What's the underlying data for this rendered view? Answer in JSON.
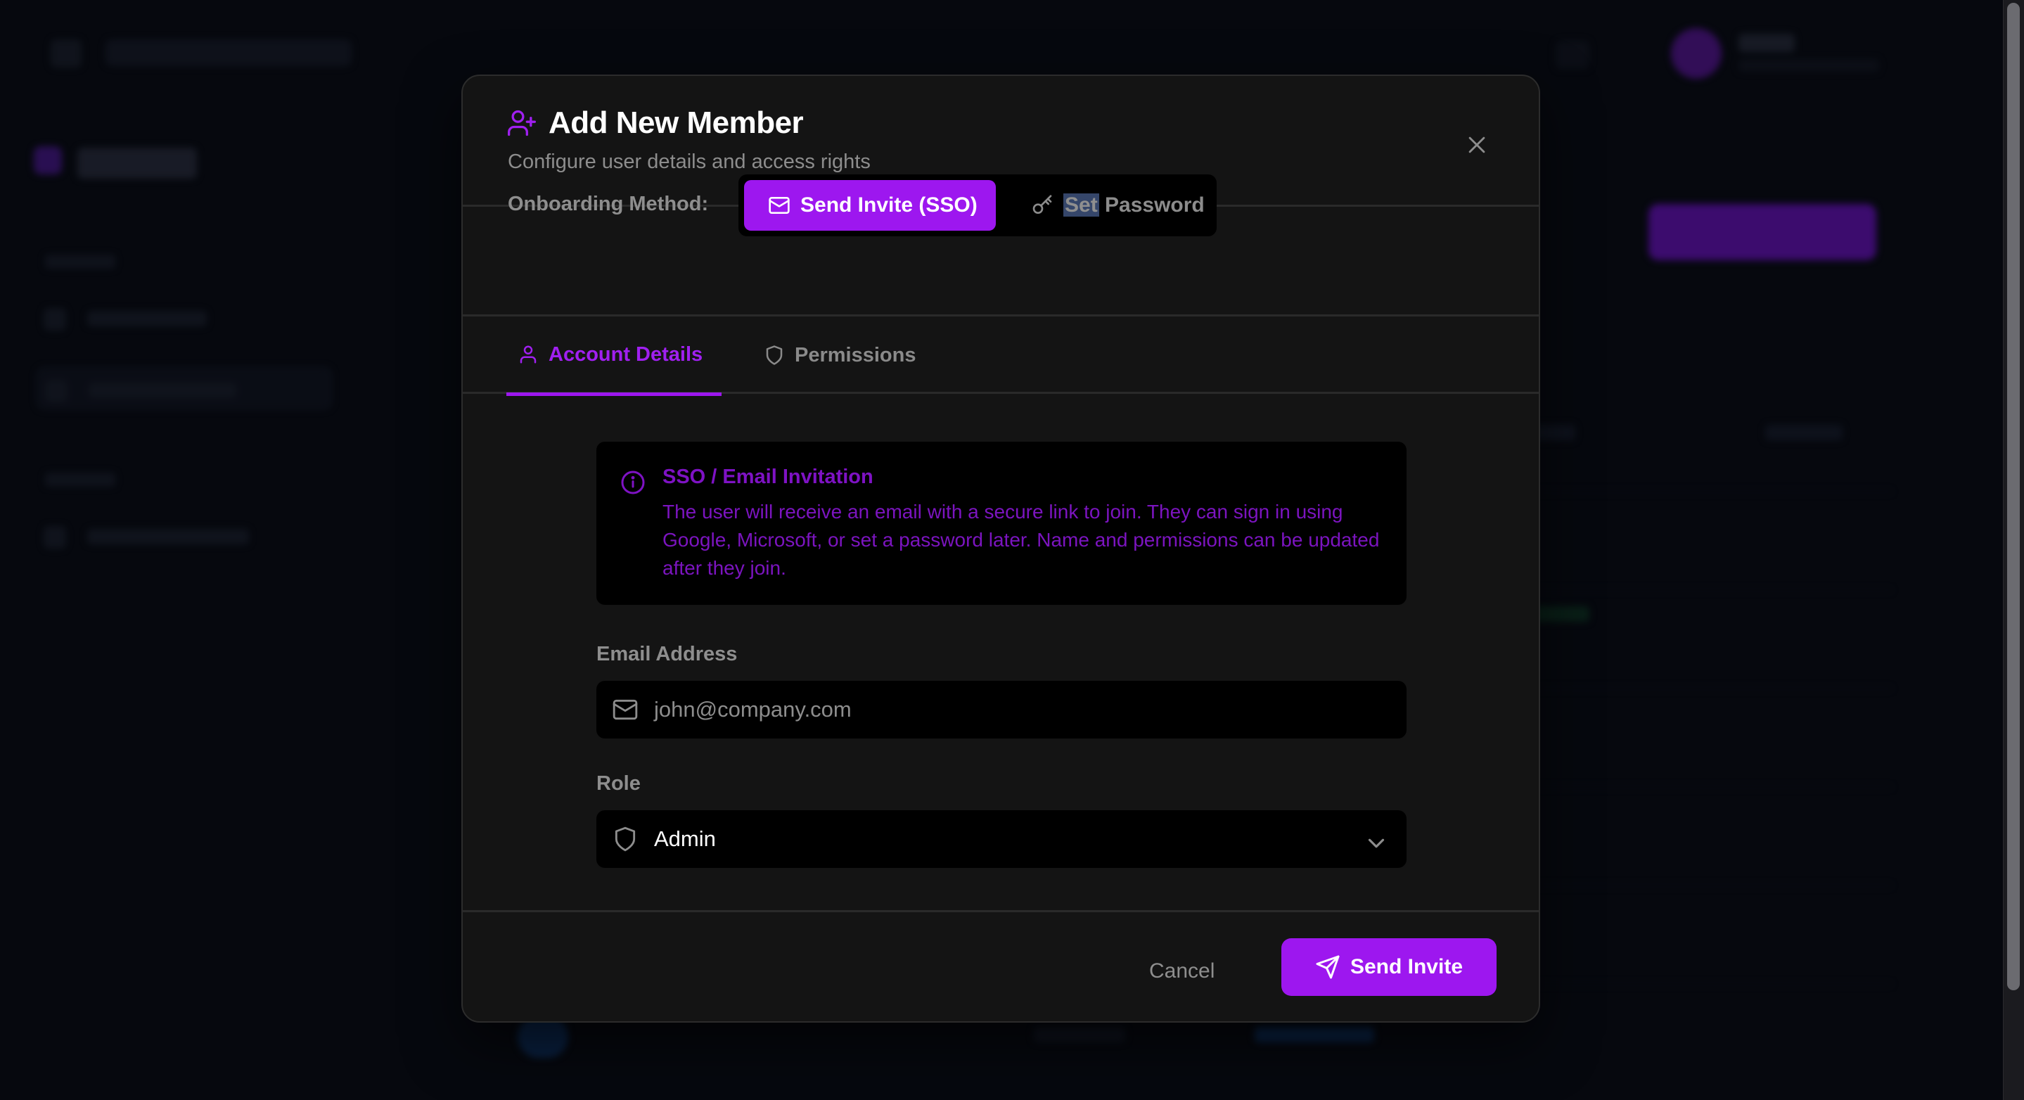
{
  "modal": {
    "title": "Add New Member",
    "subtitle": "Configure user details and access rights",
    "close_icon": "close-icon",
    "title_icon": "user-plus-icon"
  },
  "onboarding": {
    "label": "Onboarding Method:",
    "options": [
      {
        "label": "Send Invite (SSO)",
        "icon": "mail-icon",
        "selected": true
      },
      {
        "label_highlighted": "Set",
        "label_rest": " Password",
        "icon": "key-icon",
        "selected": false
      }
    ]
  },
  "tabs": [
    {
      "label": "Account Details",
      "icon": "user-icon",
      "active": true
    },
    {
      "label": "Permissions",
      "icon": "shield-icon",
      "active": false
    }
  ],
  "info": {
    "title": "SSO / Email Invitation",
    "text": "The user will receive an email with a secure link to join. They can sign in using Google, Microsoft, or set a password later. Name and permissions can be updated after they join."
  },
  "form": {
    "email_label": "Email Address",
    "email_placeholder": "john@company.com",
    "role_label": "Role",
    "role_value": "Admin"
  },
  "footer": {
    "cancel_label": "Cancel",
    "send_label": "Send Invite"
  },
  "colors": {
    "accent": "#9d17ef",
    "modal_bg": "#141414",
    "page_bg": "#0b0f1a",
    "info_text": "#7b14bf"
  }
}
